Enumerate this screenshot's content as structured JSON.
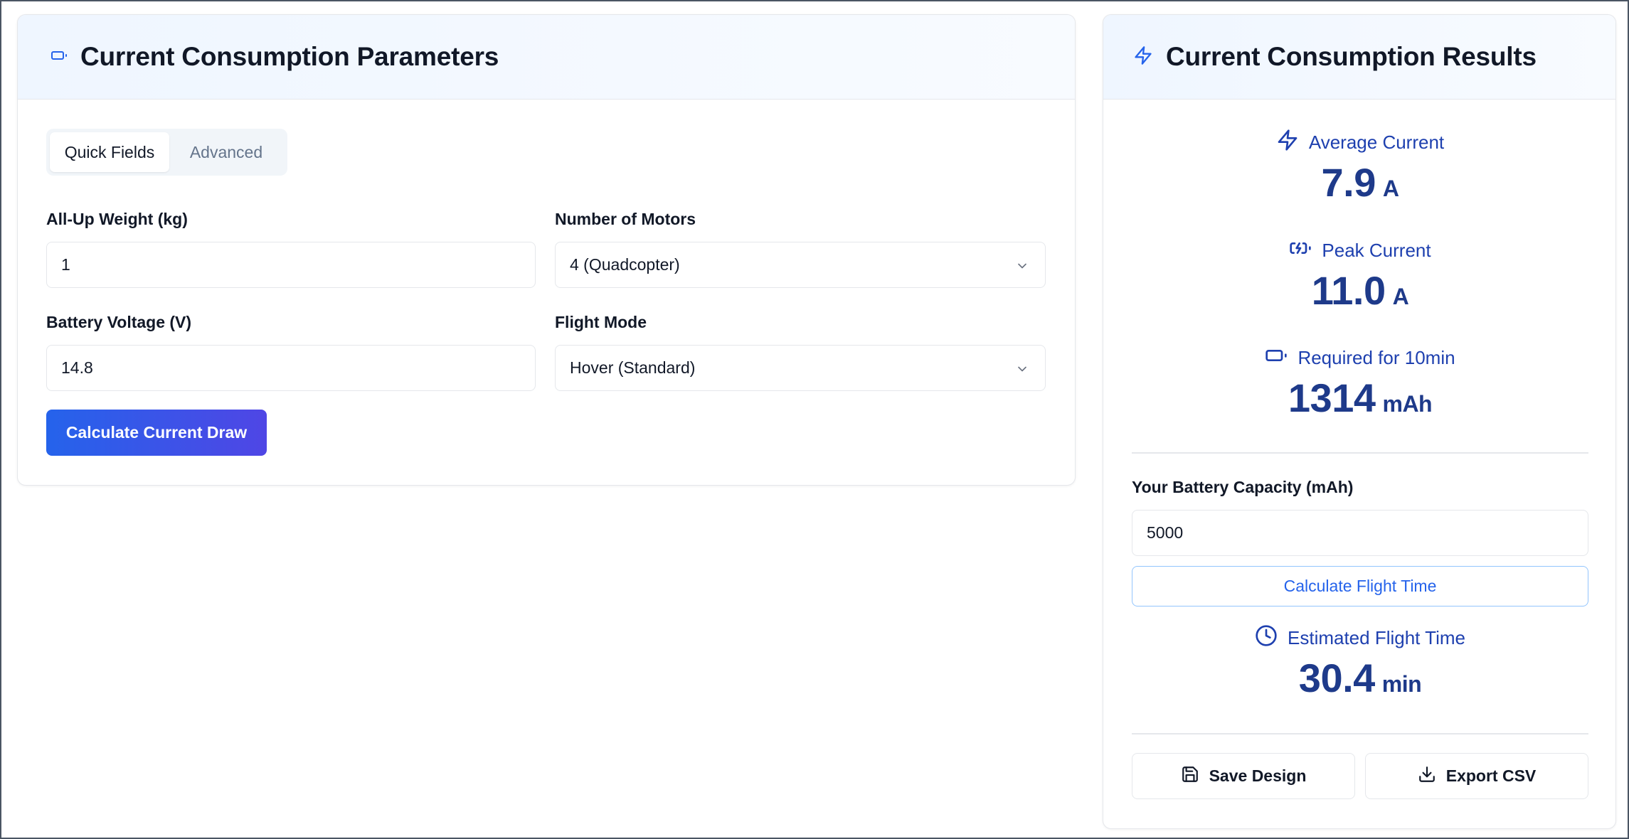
{
  "params_panel": {
    "title": "Current Consumption Parameters",
    "header_icon": "battery-icon",
    "tabs": [
      {
        "label": "Quick Fields",
        "active": true
      },
      {
        "label": "Advanced",
        "active": false
      }
    ],
    "fields": {
      "weight": {
        "label": "All-Up Weight (kg)",
        "value": "1"
      },
      "motors": {
        "label": "Number of Motors",
        "value": "4 (Quadcopter)"
      },
      "voltage": {
        "label": "Battery Voltage (V)",
        "value": "14.8"
      },
      "flight_mode": {
        "label": "Flight Mode",
        "value": "Hover (Standard)"
      }
    },
    "calculate_label": "Calculate Current Draw"
  },
  "results_panel": {
    "title": "Current Consumption Results",
    "header_icon": "zap-icon",
    "average": {
      "label": "Average Current",
      "value": "7.9",
      "unit": "A",
      "icon": "zap-icon"
    },
    "peak": {
      "label": "Peak Current",
      "value": "11.0",
      "unit": "A",
      "icon": "battery-charging-icon"
    },
    "required": {
      "label": "Required for 10min",
      "value": "1314",
      "unit": "mAh",
      "icon": "battery-icon"
    },
    "capacity": {
      "label": "Your Battery Capacity (mAh)",
      "value": "5000"
    },
    "flight_time_button": "Calculate Flight Time",
    "estimated": {
      "label": "Estimated Flight Time",
      "value": "30.4",
      "unit": "min",
      "icon": "clock-icon"
    },
    "save_label": "Save Design",
    "export_label": "Export CSV"
  },
  "colors": {
    "accent": "#2563eb",
    "accent_dark": "#1e3a8a",
    "gradient_end": "#4f46e5",
    "border": "#e5e7eb"
  }
}
